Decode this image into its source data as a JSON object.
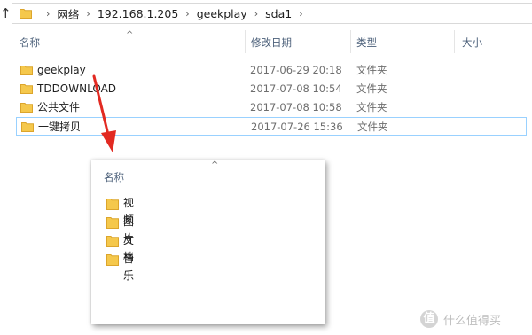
{
  "address_bar": {
    "up_icon": "up-arrow-icon",
    "breadcrumbs": [
      "网络",
      "192.168.1.205",
      "geekplay",
      "sda1"
    ],
    "separator": "›"
  },
  "columns": {
    "sort_indicator": "^",
    "name": "名称",
    "date_modified": "修改日期",
    "type": "类型",
    "size": "大小"
  },
  "files": [
    {
      "name": "geekplay",
      "date": "2017-06-29 20:18",
      "type": "文件夹",
      "icon": "folder-icon"
    },
    {
      "name": "TDDOWNLOAD",
      "date": "2017-07-08 10:54",
      "type": "文件夹",
      "icon": "folder-icon"
    },
    {
      "name": "公共文件",
      "date": "2017-07-08 10:58",
      "type": "文件夹",
      "icon": "folder-icon"
    },
    {
      "name": "一键拷贝",
      "date": "2017-07-26 15:36",
      "type": "文件夹",
      "icon": "folder-icon",
      "selected": true
    }
  ],
  "popup": {
    "sort_indicator": "^",
    "header": "名称",
    "items": [
      {
        "name": "视频",
        "icon": "folder-icon"
      },
      {
        "name": "图片",
        "icon": "folder-icon"
      },
      {
        "name": "文档",
        "icon": "folder-icon"
      },
      {
        "name": "音乐",
        "icon": "folder-icon"
      }
    ]
  },
  "watermark": {
    "badge": "值",
    "text": "什么值得买"
  },
  "colors": {
    "folder": "#f5c84c",
    "folder_dark": "#e0a92a",
    "selection_border": "#99d1ff",
    "header_text": "#4c607a",
    "arrow": "#e22a22"
  }
}
